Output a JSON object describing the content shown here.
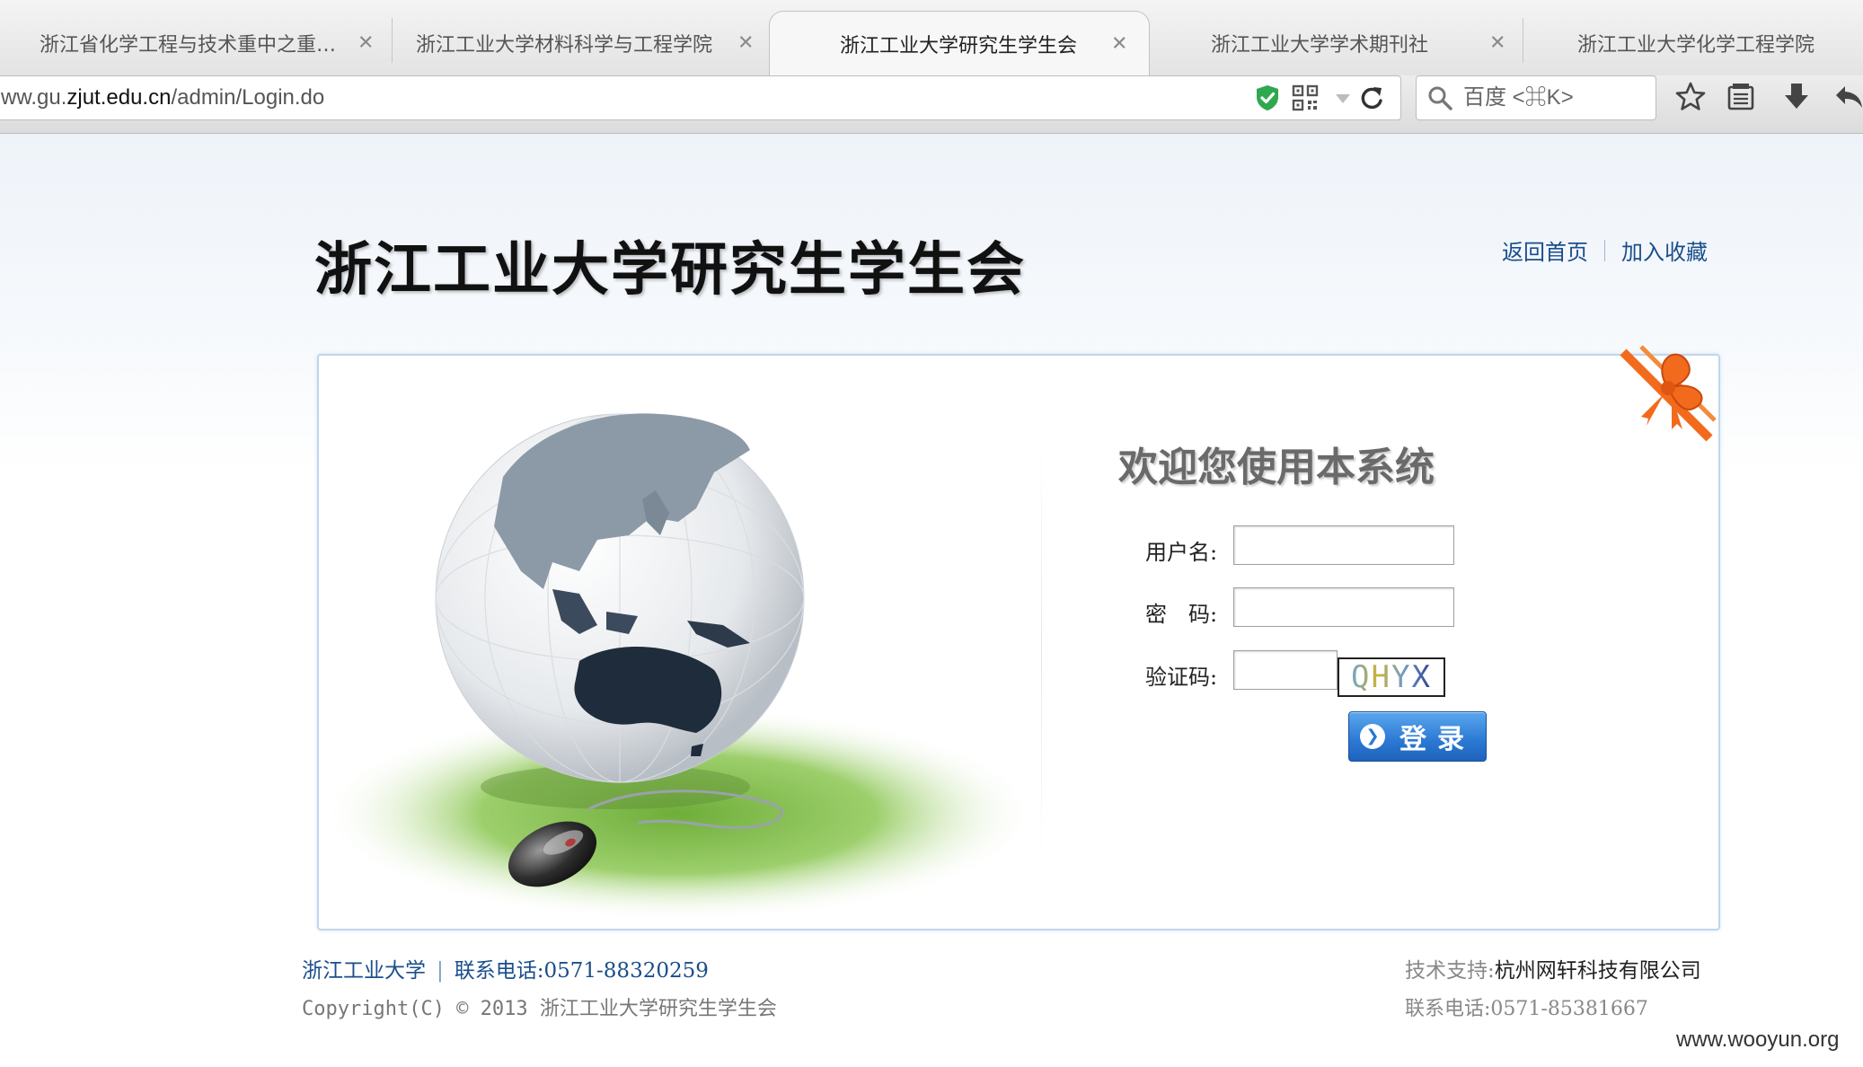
{
  "browser": {
    "tabs": [
      {
        "title": "浙江省化学工程与技术重中之重…",
        "close": "✕"
      },
      {
        "title": "浙江工业大学材料科学与工程学院",
        "close": "✕"
      },
      {
        "title": "浙江工业大学研究生学生会",
        "close": "✕",
        "active": true
      },
      {
        "title": "浙江工业大学学术期刊社",
        "close": "✕"
      },
      {
        "title": "浙江工业大学化学工程学院"
      }
    ],
    "url_prefix": "ww.gu.",
    "url_host": "zjut.edu.cn",
    "url_path": "/admin/Login.do",
    "search_placeholder": "百度 <⌘K>",
    "icons": [
      "shield-check-icon",
      "qr-code-icon",
      "dropdown-icon",
      "reload-icon",
      "search-icon",
      "star-icon",
      "reading-list-icon",
      "download-icon",
      "back-icon"
    ],
    "colors": {
      "shield": "#2fa84f"
    }
  },
  "header": {
    "site_title": "浙江工业大学研究生学生会",
    "links": [
      "返回首页",
      "加入收藏"
    ]
  },
  "login": {
    "welcome": "欢迎您使用本系统",
    "username_label": "用户名:",
    "password_label": "密　码:",
    "captcha_label": "验证码:",
    "username_value": "",
    "password_value": "",
    "captcha_value": "",
    "captcha_text": "QHYX",
    "login_button": "登录",
    "colors": {
      "button": "#2b78d4"
    }
  },
  "footer": {
    "university": "浙江工业大学",
    "phone_label": "联系电话:0571-88320259",
    "copyright": "Copyright(C) © 2013 浙江工业大学研究生学生会",
    "support_label": "技术支持:",
    "support_company": "杭州网轩科技有限公司",
    "support_phone": "联系电话:0571-85381667"
  },
  "watermark": "www.wooyun.org"
}
